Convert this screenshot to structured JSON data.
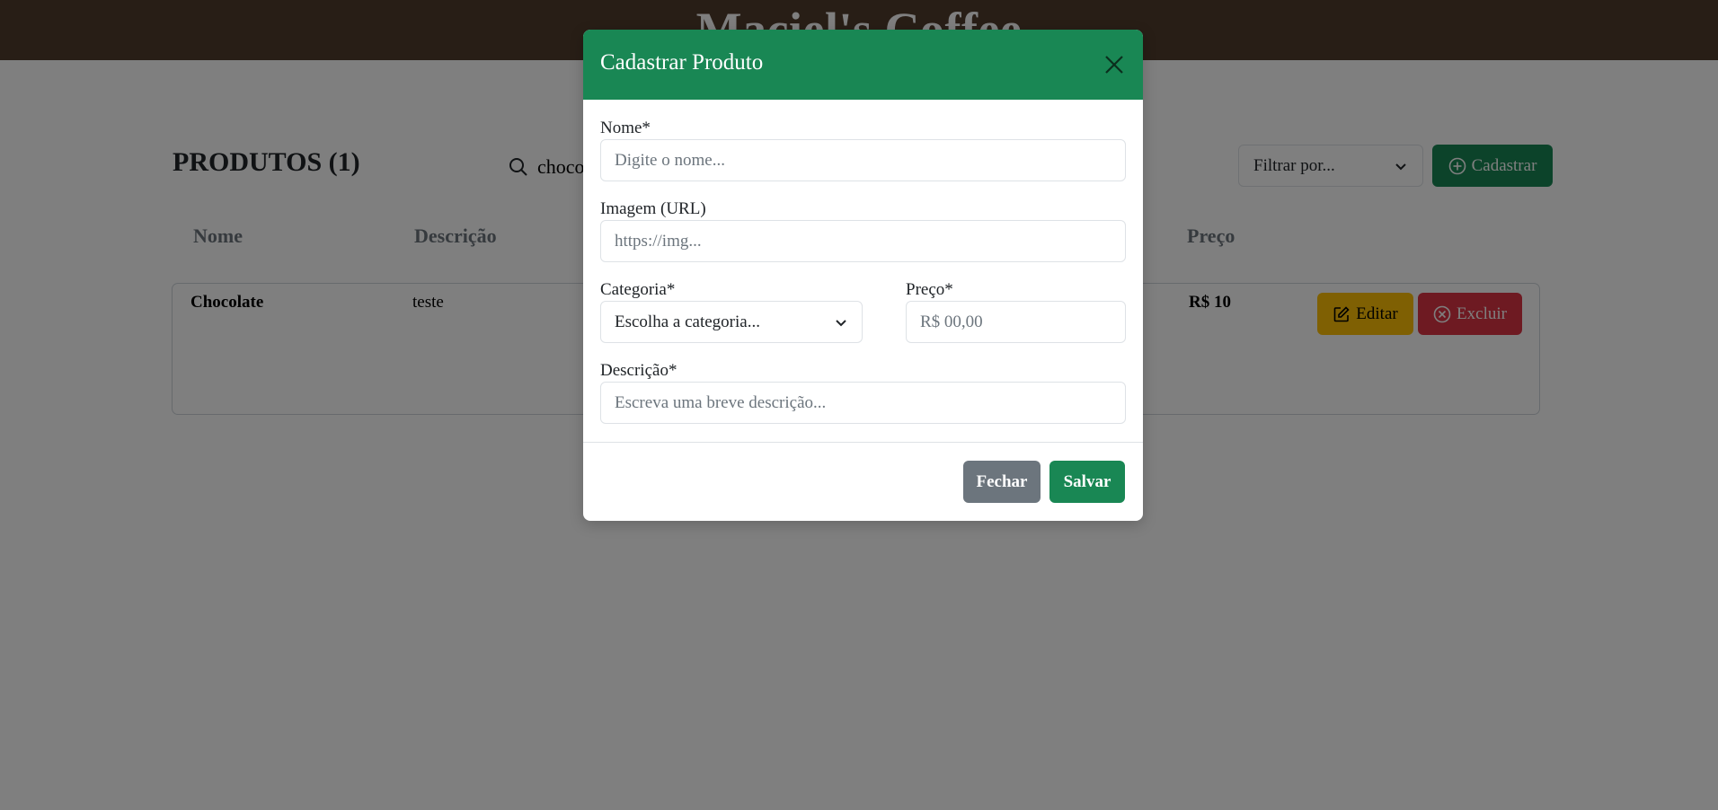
{
  "header": {
    "brand": "Maciel's Coffee"
  },
  "toolbar": {
    "page_title": "PRODUTOS (1)",
    "search_value": "chocolate",
    "filter_selected": "Filtrar por...",
    "register_label": "Cadastrar"
  },
  "table": {
    "columns": [
      "Nome",
      "Descrição",
      "Preço"
    ],
    "rows": [
      {
        "name": "Chocolate",
        "description": "teste",
        "price": "R$ 10",
        "edit_label": "Editar",
        "delete_label": "Excluir"
      }
    ]
  },
  "modal": {
    "title": "Cadastrar Produto",
    "name_label": "Nome*",
    "name_placeholder": "Digite o nome...",
    "image_label": "Imagem (URL)",
    "image_placeholder": "https://img...",
    "category_label": "Categoria*",
    "category_selected": "Escolha a categoria...",
    "price_label": "Preço*",
    "price_placeholder": "R$ 00,00",
    "description_label": "Descrição*",
    "description_placeholder": "Escreva uma breve descrição...",
    "close_label": "Fechar",
    "save_label": "Salvar"
  },
  "colors": {
    "header_bg": "#513c2c",
    "primary": "#198754",
    "secondary": "#6c757d",
    "warning": "#ffc107",
    "danger": "#dc3545"
  },
  "icons": [
    "search-icon",
    "chevron-down-icon",
    "plus-circle-icon",
    "edit-icon",
    "x-circle-icon",
    "close-icon"
  ]
}
